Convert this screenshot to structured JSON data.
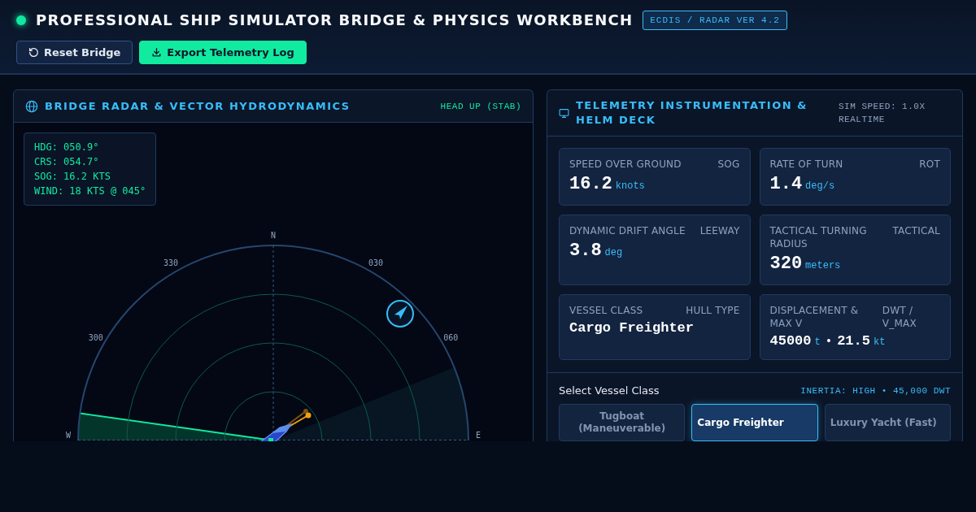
{
  "header": {
    "title": "PROFESSIONAL SHIP SIMULATOR BRIDGE & PHYSICS WORKBENCH",
    "badge": "ECDIS / RADAR VER 4.2",
    "buttons": [
      {
        "kind": "reset",
        "label": "Reset Bridge"
      },
      {
        "kind": "export",
        "label": "Export Telemetry Log"
      }
    ]
  },
  "radar_panel": {
    "title": "BRIDGE RADAR & VECTOR HYDRODYNAMICS",
    "mode": "HEAD UP (STAB)",
    "readout": [
      "HDG: 050.9°",
      "CRS: 054.7°",
      "SOG: 16.2 KTS",
      "WIND: 18 KTS @ 045°"
    ],
    "bearing_labels": [
      "W",
      "300",
      "330",
      "N",
      "030",
      "060",
      "E"
    ]
  },
  "telemetry_panel": {
    "title": "TELEMETRY INSTRUMENTATION & HELM DECK",
    "sim_speed": "SIM SPEED: 1.0X REALTIME",
    "cards": [
      {
        "kind": "metric",
        "label": "SPEED OVER GROUND",
        "tag": "SOG",
        "value": "16.2",
        "unit": "knots"
      },
      {
        "kind": "metric",
        "label": "RATE OF TURN",
        "tag": "ROT",
        "value": "1.4",
        "unit": "deg/s"
      },
      {
        "kind": "metric",
        "label": "DYNAMIC DRIFT ANGLE",
        "tag": "LEEWAY",
        "value": "3.8",
        "unit": "deg"
      },
      {
        "kind": "metric",
        "label": "TACTICAL TURNING RADIUS",
        "tag": "TACTICAL",
        "value": "320",
        "unit": "meters"
      },
      {
        "kind": "text",
        "label": "VESSEL CLASS",
        "tag": "HULL TYPE",
        "value": "Cargo Freighter"
      },
      {
        "kind": "pair",
        "label": "DISPLACEMENT & MAX V",
        "tag": "DWT / V_MAX",
        "values": [
          {
            "value": "45000",
            "unit": "t"
          },
          {
            "value": "21.5",
            "unit": "kt"
          }
        ],
        "separator": "•"
      }
    ],
    "vessel_select": {
      "label": "Select Vessel Class",
      "inertia": "INERTIA: HIGH • 45,000 DWT",
      "options": [
        {
          "label": "Tugboat (Maneuverable)",
          "selected": false
        },
        {
          "label": "Cargo Freighter",
          "selected": true
        },
        {
          "label": "Luxury Yacht (Fast)",
          "selected": false
        }
      ]
    }
  }
}
